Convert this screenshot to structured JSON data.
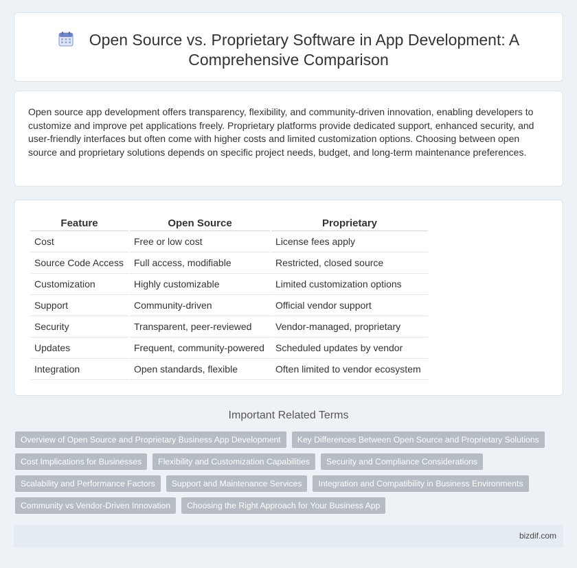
{
  "header": {
    "title_line1": "Open Source vs. Proprietary Software in App Development: A",
    "title_line2": "Comprehensive Comparison",
    "icon": "calendar-icon"
  },
  "intro": {
    "text": "Open source app development offers transparency, flexibility, and community-driven innovation, enabling developers to customize and improve pet applications freely. Proprietary platforms provide dedicated support, enhanced security, and user-friendly interfaces but often come with higher costs and limited customization options. Choosing between open source and proprietary solutions depends on specific project needs, budget, and long-term maintenance preferences."
  },
  "table": {
    "headers": [
      "Feature",
      "Open Source",
      "Proprietary"
    ],
    "rows": [
      [
        "Cost",
        "Free or low cost",
        "License fees apply"
      ],
      [
        "Source Code Access",
        "Full access, modifiable",
        "Restricted, closed source"
      ],
      [
        "Customization",
        "Highly customizable",
        "Limited customization options"
      ],
      [
        "Support",
        "Community-driven",
        "Official vendor support"
      ],
      [
        "Security",
        "Transparent, peer-reviewed",
        "Vendor-managed, proprietary"
      ],
      [
        "Updates",
        "Frequent, community-powered",
        "Scheduled updates by vendor"
      ],
      [
        "Integration",
        "Open standards, flexible",
        "Often limited to vendor ecosystem"
      ]
    ]
  },
  "related": {
    "heading": "Important Related Terms",
    "tags": [
      "Overview of Open Source and Proprietary Business App Development",
      "Key Differences Between Open Source and Proprietary Solutions",
      "Cost Implications for Businesses",
      "Flexibility and Customization Capabilities",
      "Security and Compliance Considerations",
      "Scalability and Performance Factors",
      "Support and Maintenance Services",
      "Integration and Compatibility in Business Environments",
      "Community vs Vendor-Driven Innovation",
      "Choosing the Right Approach for Your Business App"
    ]
  },
  "footer": {
    "site": "bizdif.com"
  }
}
